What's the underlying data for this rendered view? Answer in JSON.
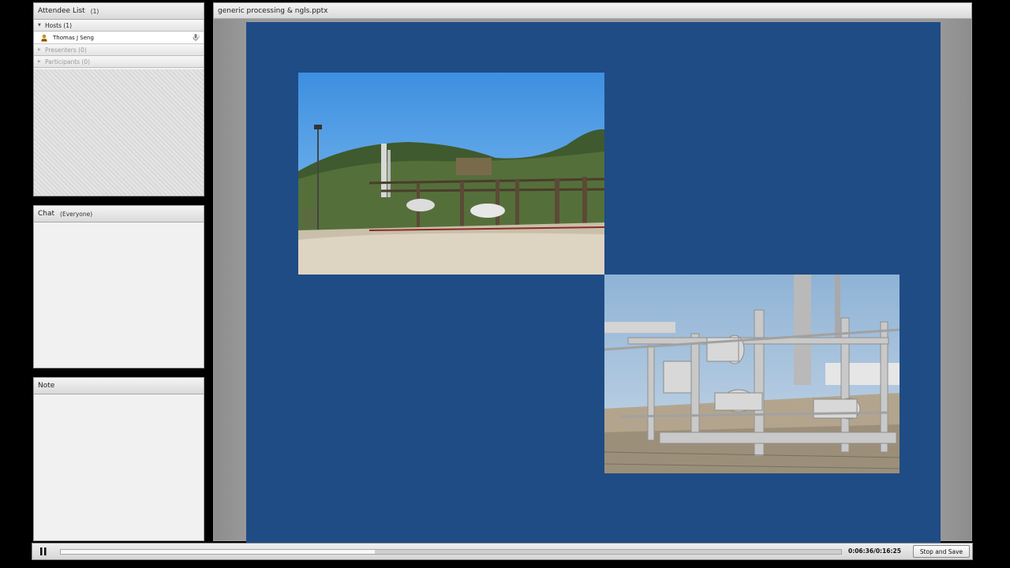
{
  "attendee_list": {
    "title": "Attendee List",
    "count": "(1)",
    "groups": [
      {
        "label": "Hosts (1)",
        "expanded": true,
        "users": [
          {
            "name": "Thomas J Seng",
            "role_icon": "host-icon",
            "status_icon": "microphone-icon"
          }
        ]
      },
      {
        "label": "Presenters (0)",
        "expanded": false
      },
      {
        "label": "Participants (0)",
        "expanded": false
      }
    ]
  },
  "chat": {
    "title": "Chat",
    "scope": "(Everyone)"
  },
  "note": {
    "title": "Note"
  },
  "share": {
    "title": "generic processing & ngls.pptx",
    "slide_background": "#1f4c85",
    "images": [
      "photo-gas-processing-plant-hillside",
      "photo-processing-skid-equipment"
    ]
  },
  "playback": {
    "time": "0:06:36/0:16:25",
    "progress_fraction": 0.402,
    "stop_save_label": "Stop and Save",
    "pause_icon": "pause-icon"
  }
}
